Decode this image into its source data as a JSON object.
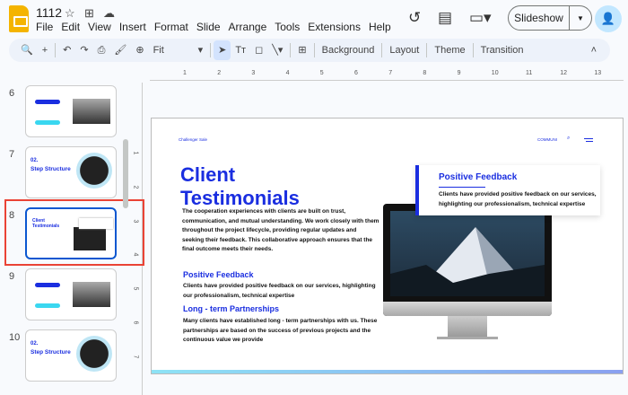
{
  "app": {
    "doc_title": "1112",
    "menu": [
      "File",
      "Edit",
      "View",
      "Insert",
      "Format",
      "Slide",
      "Arrange",
      "Tools",
      "Extensions",
      "Help"
    ],
    "slideshow_label": "Slideshow"
  },
  "toolbar": {
    "zoom": "Fit",
    "background": "Background",
    "layout": "Layout",
    "theme": "Theme",
    "transition": "Transition"
  },
  "ruler": {
    "top": [
      "1",
      "2",
      "3",
      "4",
      "5",
      "6",
      "7",
      "8",
      "9",
      "10",
      "11",
      "12",
      "13"
    ],
    "left": [
      "1",
      "2",
      "3",
      "4",
      "5",
      "6",
      "7"
    ]
  },
  "thumbnails": [
    {
      "number": "6"
    },
    {
      "number": "7",
      "title": "Step Structure",
      "sub": "02."
    },
    {
      "number": "8",
      "title": "Client Testimonials",
      "selected": true
    },
    {
      "number": "9"
    },
    {
      "number": "10",
      "title": "Step Structure",
      "sub": "02."
    }
  ],
  "slide": {
    "brand": "Challenger Sale",
    "nav": "COMMUNI",
    "title_line1": "Client",
    "title_line2": "Testimonials",
    "intro": "The cooperation experiences with clients are built on trust, communication, and mutual understanding. We work closely with them throughout the project lifecycle, providing regular updates and seeking their feedback. This collaborative approach ensures that the final outcome meets their needs.",
    "section1_title": "Positive Feedback",
    "section1_text": "Clients have provided positive feedback on our services, highlighting our professionalism, technical expertise",
    "section2_title": "Long - term Partnerships",
    "section2_text": "Many clients have established long - term partnerships with us. These partnerships are based on the success of previous projects and the continuous value we provide",
    "card_title": "Positive Feedback",
    "card_text": "Clients have provided positive feedback on our services, highlighting our professionalism, technical expertise"
  },
  "colors": {
    "accent": "#1a2ee0",
    "selection": "#ea4335",
    "logo": "#f4b400"
  }
}
